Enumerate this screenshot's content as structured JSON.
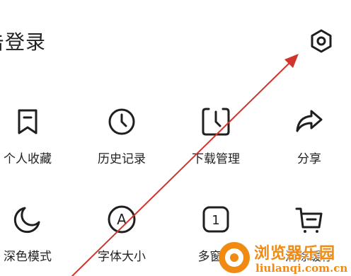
{
  "header": {
    "title": "击登录"
  },
  "settings_icon": "settings-gear-icon",
  "grid": [
    {
      "label": "个人收藏",
      "icon": "bookmark-icon"
    },
    {
      "label": "历史记录",
      "icon": "clock-icon"
    },
    {
      "label": "下载管理",
      "icon": "download-manager-icon"
    },
    {
      "label": "分享",
      "icon": "share-icon"
    },
    {
      "label": "深色模式",
      "icon": "moon-icon"
    },
    {
      "label": "字体大小",
      "icon": "font-size-icon"
    },
    {
      "label": "多窗口",
      "icon": "multi-window-icon"
    },
    {
      "label": "清除缓存",
      "icon": "cart-icon"
    }
  ],
  "multi_window_count": "1",
  "font_icon_letter": "A",
  "watermark": {
    "text": "浏览器乐园",
    "url": "liulanqi.com.cn"
  },
  "colors": {
    "arrow": "#d0342c",
    "watermark": "#f08a12",
    "icon": "#1f1f1f"
  }
}
